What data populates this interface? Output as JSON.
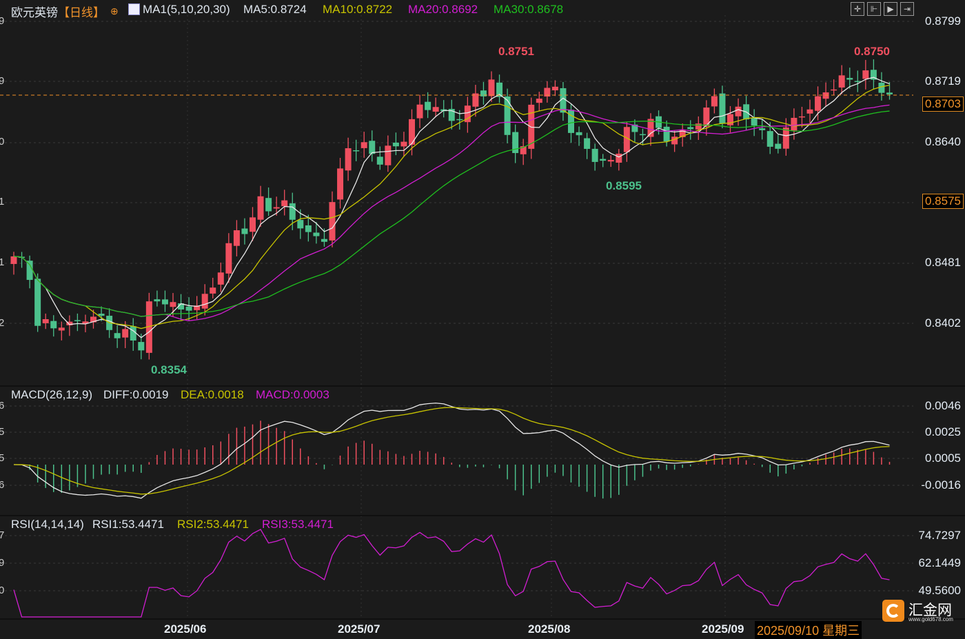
{
  "header": {
    "symbol": "欧元英镑",
    "period": "【日线】",
    "ma_title": "MA1(5,10,20,30)",
    "ma5": "MA5:0.8724",
    "ma10": "MA10:0.8722",
    "ma20": "MA20:0.8692",
    "ma30": "MA30:0.8678"
  },
  "macd_header": {
    "title": "MACD(26,12,9)",
    "diff": "DIFF:0.0019",
    "dea": "DEA:0.0018",
    "macd": "MACD:0.0003"
  },
  "rsi_header": {
    "title": "RSI(14,14,14)",
    "rsi1": "RSI1:53.4471",
    "rsi2": "RSI2:53.4471",
    "rsi3": "RSI3:53.4471"
  },
  "price_axis": [
    "0.8799",
    "0.8719",
    "0.8640",
    "0.8575",
    "0.8481",
    "0.8402"
  ],
  "current_price": "0.8703",
  "left_axis": [
    "9",
    "9",
    "0",
    "1",
    "1",
    "2",
    "6",
    "5",
    "5",
    "6",
    "7",
    "9",
    "0"
  ],
  "macd_axis": [
    "0.0046",
    "0.0025",
    "0.0005",
    "-0.0016"
  ],
  "rsi_axis": [
    "74.7297",
    "62.1449",
    "49.5600"
  ],
  "dates": [
    "2025/06",
    "2025/07",
    "2025/08",
    "2025/09"
  ],
  "cursor_date": "2025/09/10 星期三",
  "annotations": {
    "high1": "0.8751",
    "low1": "0.8354",
    "low2": "0.8595",
    "high2": "0.8750"
  },
  "logo": {
    "name": "汇金网",
    "url": "www.gold678.com"
  },
  "toolbar": [
    "crosshair-icon",
    "zoom-range-icon",
    "play-icon",
    "scroll-end-icon"
  ],
  "colors": {
    "up": "#ef4f5f",
    "down": "#4cc18c",
    "ma5": "#e8e8e8",
    "ma10": "#c8c400",
    "ma20": "#d21ed2",
    "ma30": "#1fbf1f",
    "accent": "#f0922a"
  },
  "chart_data": {
    "type": "candlestick",
    "title": "欧元英镑 日线",
    "ylim": [
      0.833,
      0.882
    ],
    "close_keypoints": [
      [
        0,
        0.849
      ],
      [
        2,
        0.847
      ],
      [
        3,
        0.8405
      ],
      [
        5,
        0.8405
      ],
      [
        8,
        0.841
      ],
      [
        10,
        0.842
      ],
      [
        12,
        0.84
      ],
      [
        15,
        0.838
      ],
      [
        16,
        0.8375
      ],
      [
        17,
        0.842
      ],
      [
        19,
        0.843
      ],
      [
        21,
        0.841
      ],
      [
        23,
        0.842
      ],
      [
        25,
        0.844
      ],
      [
        27,
        0.85
      ],
      [
        30,
        0.854
      ],
      [
        31,
        0.856
      ],
      [
        34,
        0.856
      ],
      [
        37,
        0.8525
      ],
      [
        39,
        0.852
      ],
      [
        40,
        0.857
      ],
      [
        42,
        0.864
      ],
      [
        43,
        0.864
      ],
      [
        46,
        0.862
      ],
      [
        48,
        0.863
      ],
      [
        50,
        0.866
      ],
      [
        51,
        0.868
      ],
      [
        53,
        0.868
      ],
      [
        55,
        0.866
      ],
      [
        57,
        0.868
      ],
      [
        60,
        0.872
      ],
      [
        63,
        0.863
      ],
      [
        64,
        0.863
      ],
      [
        65,
        0.87
      ],
      [
        68,
        0.872
      ],
      [
        70,
        0.866
      ],
      [
        72,
        0.864
      ],
      [
        74,
        0.861
      ],
      [
        75,
        0.862
      ],
      [
        77,
        0.865
      ],
      [
        78,
        0.865
      ],
      [
        80,
        0.866
      ],
      [
        82,
        0.864
      ],
      [
        83,
        0.864
      ],
      [
        85,
        0.865
      ],
      [
        88,
        0.869
      ],
      [
        89,
        0.867
      ],
      [
        92,
        0.868
      ],
      [
        94,
        0.865
      ],
      [
        96,
        0.864
      ],
      [
        98,
        0.868
      ],
      [
        100,
        0.869
      ],
      [
        102,
        0.8715
      ],
      [
        103,
        0.872
      ],
      [
        106,
        0.873
      ],
      [
        108,
        0.872
      ],
      [
        110,
        0.8703
      ]
    ],
    "ma_periods": [
      5,
      10,
      20,
      30
    ],
    "macd_ylim": [
      -0.0032,
      0.005
    ],
    "rsi_ylim": [
      40,
      85
    ]
  }
}
